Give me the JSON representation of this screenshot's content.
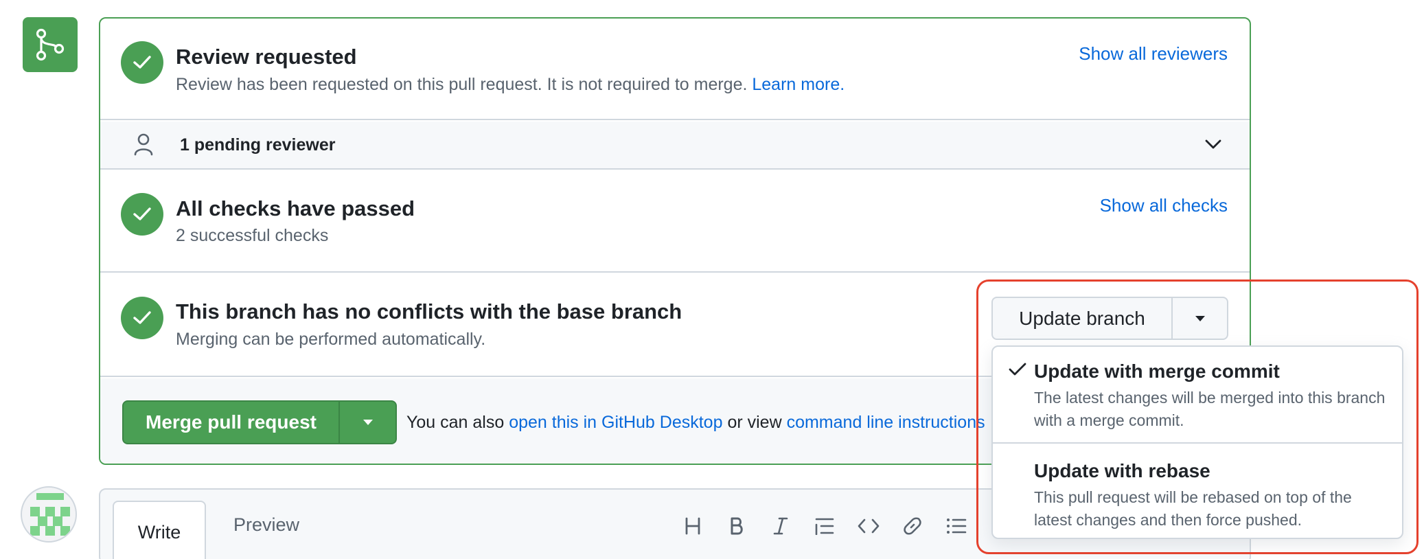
{
  "review": {
    "title": "Review requested",
    "description": "Review has been requested on this pull request. It is not required to merge.",
    "learn_more": "Learn more.",
    "show_all": "Show all reviewers"
  },
  "pending": {
    "label": "1 pending reviewer"
  },
  "checks": {
    "title": "All checks have passed",
    "subtitle": "2 successful checks",
    "show_all": "Show all checks"
  },
  "conflicts": {
    "title": "This branch has no conflicts with the base branch",
    "subtitle": "Merging can be performed automatically."
  },
  "update_branch": {
    "label": "Update branch",
    "options": [
      {
        "title": "Update with merge commit",
        "description": "The latest changes will be merged into this branch with a merge commit.",
        "selected": true
      },
      {
        "title": "Update with rebase",
        "description": "This pull request will be rebased on top of the latest changes and then force pushed.",
        "selected": false
      }
    ]
  },
  "merge": {
    "button_label": "Merge pull request",
    "also_prefix": "You can also",
    "desktop_link": "open this in GitHub Desktop",
    "or_view": "or view",
    "cli_link": "command line instructions"
  },
  "editor": {
    "tab_write": "Write",
    "tab_preview": "Preview",
    "toolbar": [
      "heading-icon",
      "bold-icon",
      "italic-icon",
      "quote-icon",
      "code-icon",
      "link-icon",
      "bulleted-list-icon"
    ]
  },
  "colors": {
    "success_green": "#4a9f54",
    "link_blue": "#0969da",
    "highlight_red": "#e5412d",
    "border_gray": "#d0d7de"
  }
}
